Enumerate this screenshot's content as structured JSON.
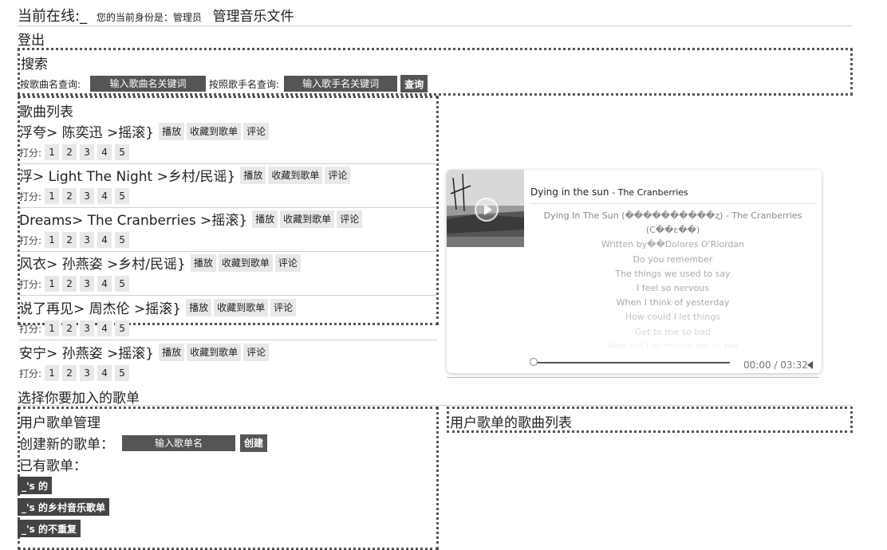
{
  "header": {
    "online_label": "当前在线:_",
    "identity_label": "您的当前身份是：管理员",
    "manage_label": "管理音乐文件",
    "logout": "登出"
  },
  "search": {
    "title": "搜索",
    "by_song_label": "按歌曲名查询:",
    "song_placeholder": "输入歌曲名关键词",
    "by_singer_label": "按照歌手名查询:",
    "singer_placeholder": "输入歌手名关键词",
    "query_button": "查询"
  },
  "song_list": {
    "title": "歌曲列表",
    "play_label": "播放",
    "collect_label": "收藏到歌单",
    "comment_label": "评论",
    "rate_label": "打分:",
    "ratings": [
      "1",
      "2",
      "3",
      "4",
      "5"
    ],
    "songs": [
      {
        "text": "浮夸> 陈奕迅 >摇滚}"
      },
      {
        "text": "浮> Light The Night >乡村/民谣}"
      },
      {
        "text": "Dreams> The Cranberries >摇滚}"
      },
      {
        "text": "风衣> 孙燕姿 >乡村/民谣}"
      },
      {
        "text": "说了再见> 周杰伦 >摇滚}"
      },
      {
        "text": "安宁> 孙燕姿 >摇滚}"
      }
    ]
  },
  "player": {
    "title": "Dying in the sun",
    "artist": "- The Cranberries",
    "lyrics": [
      "Dying In The Sun (����������ʐ) - The Cranberries",
      "(C��ε��)",
      "Written by��Dolores O'Riordan",
      "Do you remember",
      "The things we used to say",
      "I feel so nervous",
      "When I think of yesterday",
      "How could I let things",
      "Get to me so bad",
      "How did I let things get to me"
    ],
    "time": "00:00 / 03:32",
    "progress": 0
  },
  "choose_playlist": "选择你要加入的歌单",
  "user_playlists": {
    "title": "用户歌单管理",
    "create_label": "创建新的歌单：",
    "create_placeholder": "输入歌单名",
    "create_button": "创建",
    "existing_label": "已有歌单：",
    "items": [
      "_'s 的",
      "_'s 的乡村音乐歌单",
      "_'s 的不重复"
    ]
  },
  "playlist_songs_title": "用户歌单的歌曲列表"
}
